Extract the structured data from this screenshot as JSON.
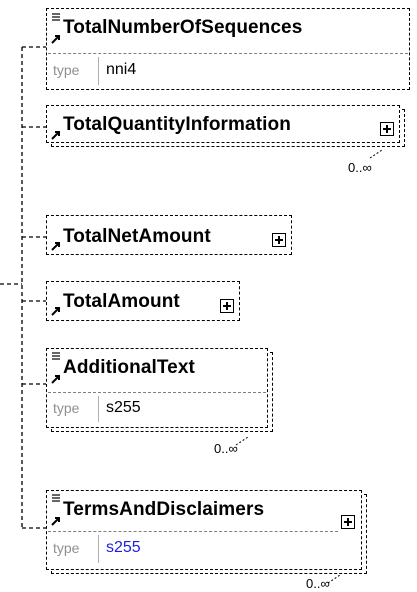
{
  "elements": [
    {
      "name": "TotalNumberOfSequences",
      "type_label": "type",
      "type_value": "nni4"
    },
    {
      "name": "TotalQuantityInformation",
      "cardinality": "0..∞"
    },
    {
      "name": "TotalNetAmount"
    },
    {
      "name": "TotalAmount"
    },
    {
      "name": "AdditionalText",
      "type_label": "type",
      "type_value": "s255",
      "cardinality": "0..∞"
    },
    {
      "name": "TermsAndDisclaimers",
      "type_label": "type",
      "type_value": "s255",
      "cardinality": "0..∞"
    }
  ],
  "colors": {
    "line": "#000000",
    "type_label": "#909090",
    "type_link": "#2020e0"
  },
  "icons": [
    "element-text-icon",
    "reference-arrow-icon",
    "expand-plus-icon"
  ]
}
